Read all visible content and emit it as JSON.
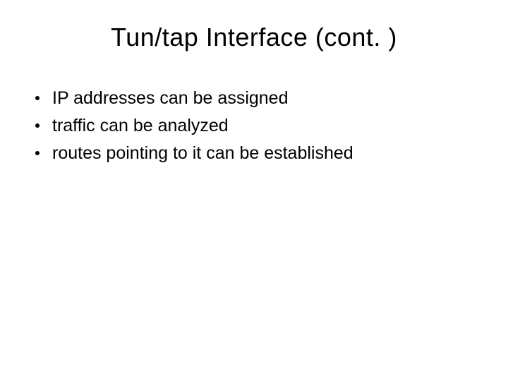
{
  "slide": {
    "title": "Tun/tap Interface (cont. )",
    "bullets": [
      "IP addresses can be assigned",
      "traffic can be analyzed",
      "routes pointing to it can be established"
    ]
  }
}
